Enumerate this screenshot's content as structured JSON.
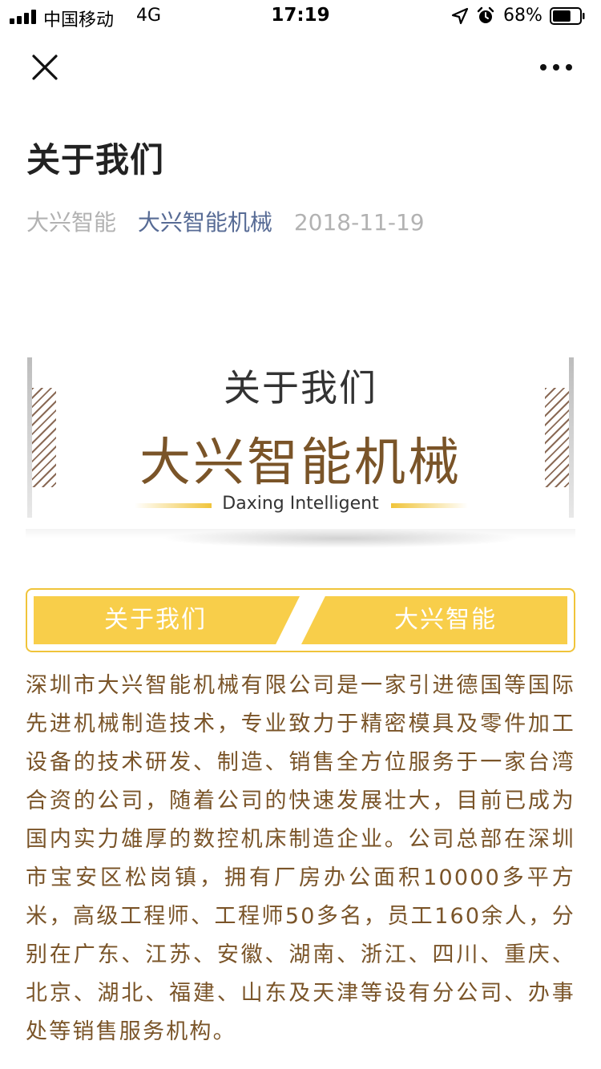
{
  "status_bar": {
    "carrier": "中国移动",
    "network": "4G",
    "time": "17:19",
    "battery_percent": "68%",
    "battery_level": 0.68,
    "icons": [
      "signal-icon",
      "location-arrow-icon",
      "alarm-clock-icon",
      "battery-icon"
    ]
  },
  "nav": {
    "close_icon": "close-icon",
    "more_icon": "more-dots-icon"
  },
  "article": {
    "title": "关于我们",
    "author": "大兴智能",
    "account": "大兴智能机械",
    "date": "2018-11-19"
  },
  "banner": {
    "subtitle": "关于我们",
    "main_title": "大兴智能机械",
    "english_name": "Daxing Intelligent",
    "accent_color": "#f0c43a",
    "title_color": "#7a5428"
  },
  "tabs": [
    {
      "label": "关于我们"
    },
    {
      "label": "大兴智能"
    }
  ],
  "content": {
    "text": "深圳市大兴智能机械有限公司是一家引进德国等国际先进机械制造技术，专业致力于精密模具及零件加工设备的技术研发、制造、销售全方位服务于一家台湾合资的公司，随着公司的快速发展壮大，目前已成为国内实力雄厚的数控机床制造企业。公司总部在深圳市宝安区松岗镇，拥有厂房办公面积10000多平方米，高级工程师、工程师50多名，员工160余人，分别在广东、江苏、安徽、湖南、浙江、四川、重庆、北京、湖北、福建、山东及天津等设有分公司、办事处等销售服务机构。",
    "text_color": "#7a5428"
  }
}
